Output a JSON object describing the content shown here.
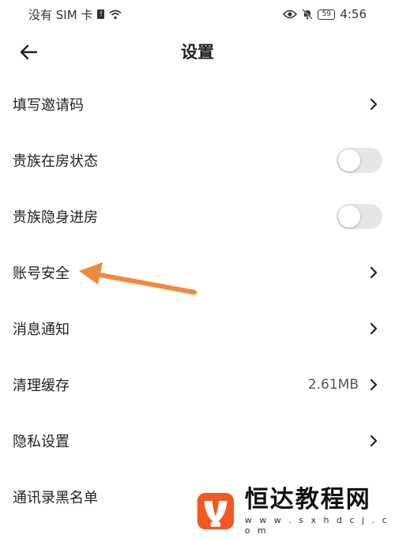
{
  "status_bar": {
    "carrier": "没有 SIM 卡",
    "battery": "59",
    "time": "4:56"
  },
  "header": {
    "title": "设置"
  },
  "settings": [
    {
      "label": "填写邀请码",
      "type": "chevron"
    },
    {
      "label": "贵族在房状态",
      "type": "toggle",
      "on": false
    },
    {
      "label": "贵族隐身进房",
      "type": "toggle",
      "on": false
    },
    {
      "label": "账号安全",
      "type": "chevron"
    },
    {
      "label": "消息通知",
      "type": "chevron"
    },
    {
      "label": "清理缓存",
      "type": "chevron",
      "value": "2.61MB"
    },
    {
      "label": "隐私设置",
      "type": "chevron"
    },
    {
      "label": "通讯录黑名单",
      "type": "chevron"
    }
  ],
  "watermark": {
    "title": "恒达教程网",
    "url": "w w w . s x h d c j . c o m"
  },
  "colors": {
    "arrow": "#f08a3a",
    "toggle_off": "#e6e6e6",
    "logo": "#f05a22"
  }
}
